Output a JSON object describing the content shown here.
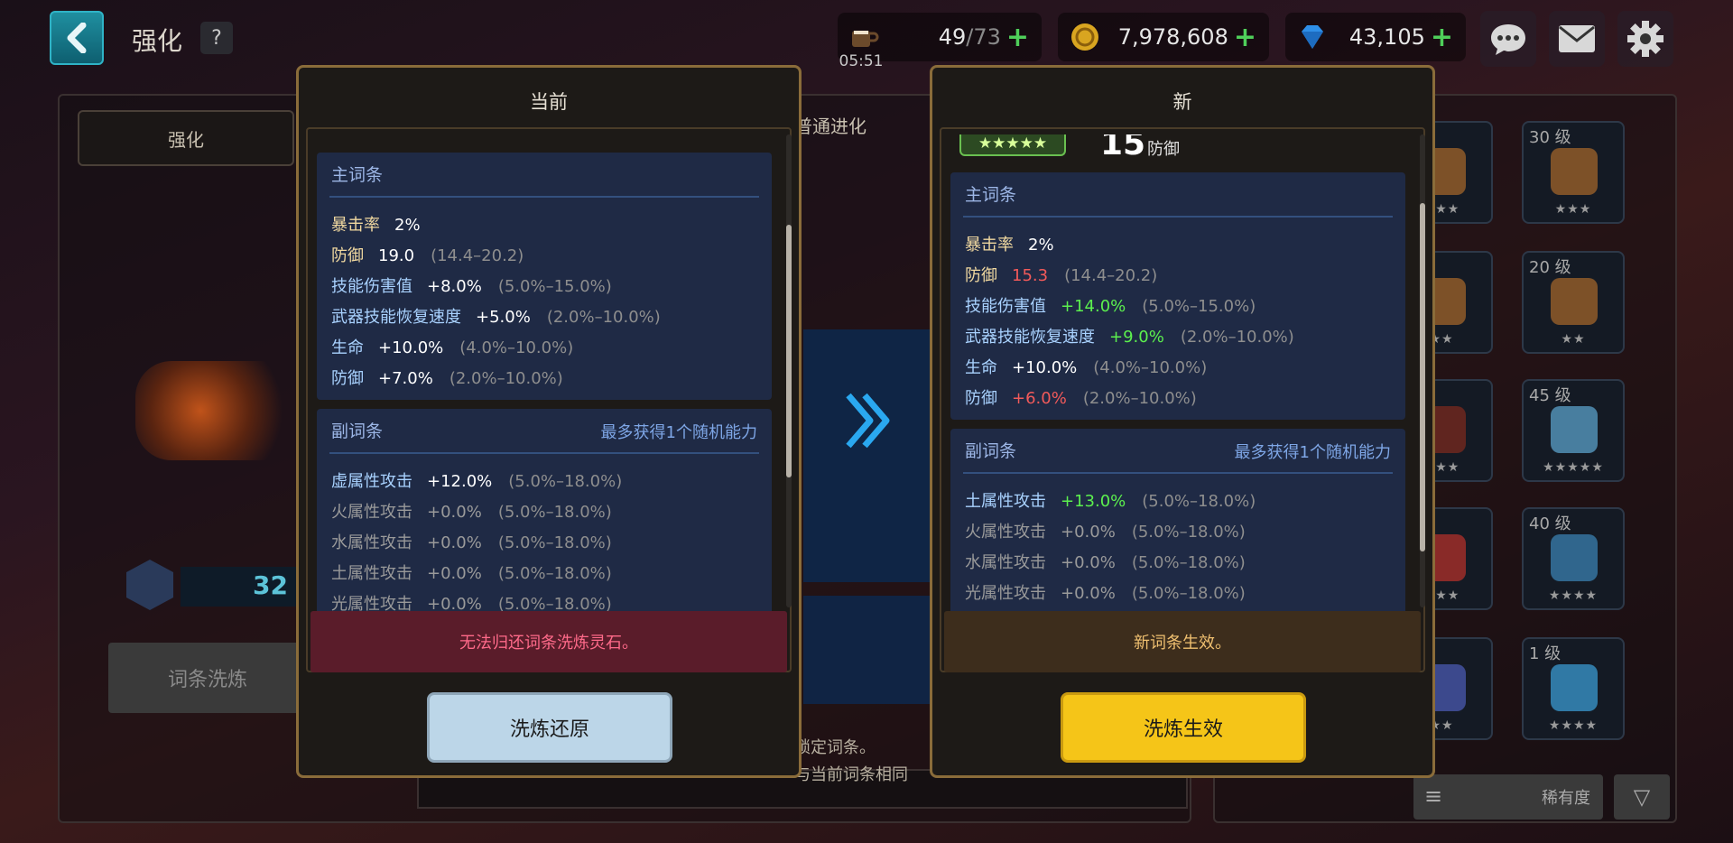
{
  "header": {
    "title": "强化",
    "help": "?",
    "stamina": {
      "current": "49",
      "max": "/73",
      "timer": "05:51"
    },
    "gold": "7,978,608",
    "gems": "43,105"
  },
  "background": {
    "tab_enhance": "强化",
    "tab_evolve": "普通进化",
    "level_number": "32",
    "reroll_button": "词条洗炼",
    "hint1": "锁定词条。",
    "hint2": "与当前词条相同"
  },
  "inventory": {
    "slots": [
      {
        "level": "",
        "stars": "★★★"
      },
      {
        "level": "30 级",
        "stars": "★★★"
      },
      {
        "level": "",
        "stars": "★★"
      },
      {
        "level": "20 级",
        "stars": "★★"
      },
      {
        "level": "",
        "stars": "★★★"
      },
      {
        "level": "45 级",
        "stars": "★★★★★"
      },
      {
        "level": "",
        "stars": "★★★"
      },
      {
        "level": "40 级",
        "stars": "★★★★"
      },
      {
        "level": "",
        "stars": "★★"
      },
      {
        "level": "1 级",
        "stars": "★★★★"
      }
    ],
    "sort_label": "稀有度"
  },
  "current": {
    "title": "当前",
    "main_header": "主词条",
    "main_stats": [
      {
        "name": "暴击率",
        "value": "2%",
        "range": ""
      },
      {
        "name": "防御",
        "value": "19.0",
        "range": "(14.4–20.2)"
      },
      {
        "name": "技能伤害值",
        "value": "+8.0%",
        "range": "(5.0%–15.0%)"
      },
      {
        "name": "武器技能恢复速度",
        "value": "+5.0%",
        "range": "(2.0%–10.0%)"
      },
      {
        "name": "生命",
        "value": "+10.0%",
        "range": "(4.0%–10.0%)"
      },
      {
        "name": "防御",
        "value": "+7.0%",
        "range": "(2.0%–10.0%)"
      }
    ],
    "sub_header": "副词条",
    "sub_note": "最多获得1个随机能力",
    "sub_stats": [
      {
        "name": "虚属性攻击",
        "value": "+12.0%",
        "range": "(5.0%–18.0%)"
      },
      {
        "name": "火属性攻击",
        "value": "+0.0%",
        "range": "(5.0%–18.0%)"
      },
      {
        "name": "水属性攻击",
        "value": "+0.0%",
        "range": "(5.0%–18.0%)"
      },
      {
        "name": "土属性攻击",
        "value": "+0.0%",
        "range": "(5.0%–18.0%)"
      },
      {
        "name": "光属性攻击",
        "value": "+0.0%",
        "range": "(5.0%–18.0%)"
      }
    ],
    "notice": "无法归还词条洗炼灵石。",
    "button": "洗炼还原"
  },
  "new": {
    "title": "新",
    "level": "15",
    "level_label": "防御",
    "stars": "★★★★★",
    "main_header": "主词条",
    "main_stats": [
      {
        "name": "暴击率",
        "value": "2%",
        "range": ""
      },
      {
        "name": "防御",
        "value": "15.3",
        "range": "(14.4–20.2)"
      },
      {
        "name": "技能伤害值",
        "value": "+14.0%",
        "range": "(5.0%–15.0%)"
      },
      {
        "name": "武器技能恢复速度",
        "value": "+9.0%",
        "range": "(2.0%–10.0%)"
      },
      {
        "name": "生命",
        "value": "+10.0%",
        "range": "(4.0%–10.0%)"
      },
      {
        "name": "防御",
        "value": "+6.0%",
        "range": "(2.0%–10.0%)"
      }
    ],
    "sub_header": "副词条",
    "sub_note": "最多获得1个随机能力",
    "sub_stats": [
      {
        "name": "土属性攻击",
        "value": "+13.0%",
        "range": "(5.0%–18.0%)"
      },
      {
        "name": "火属性攻击",
        "value": "+0.0%",
        "range": "(5.0%–18.0%)"
      },
      {
        "name": "水属性攻击",
        "value": "+0.0%",
        "range": "(5.0%–18.0%)"
      },
      {
        "name": "光属性攻击",
        "value": "+0.0%",
        "range": "(5.0%–18.0%)"
      }
    ],
    "notice": "新词条生效。",
    "button": "洗炼生效"
  },
  "colors": {
    "accent_gold": "#f5c518",
    "restore_button": "#bcd6e8",
    "notice_red_bg": "#5a1c2a",
    "notice_red_text": "#ff6a8a",
    "notice_gold_bg": "#3d2d1c",
    "notice_gold_text": "#f0c070",
    "increase_green": "#5cf04e",
    "decrease_red": "#f25a5a"
  }
}
